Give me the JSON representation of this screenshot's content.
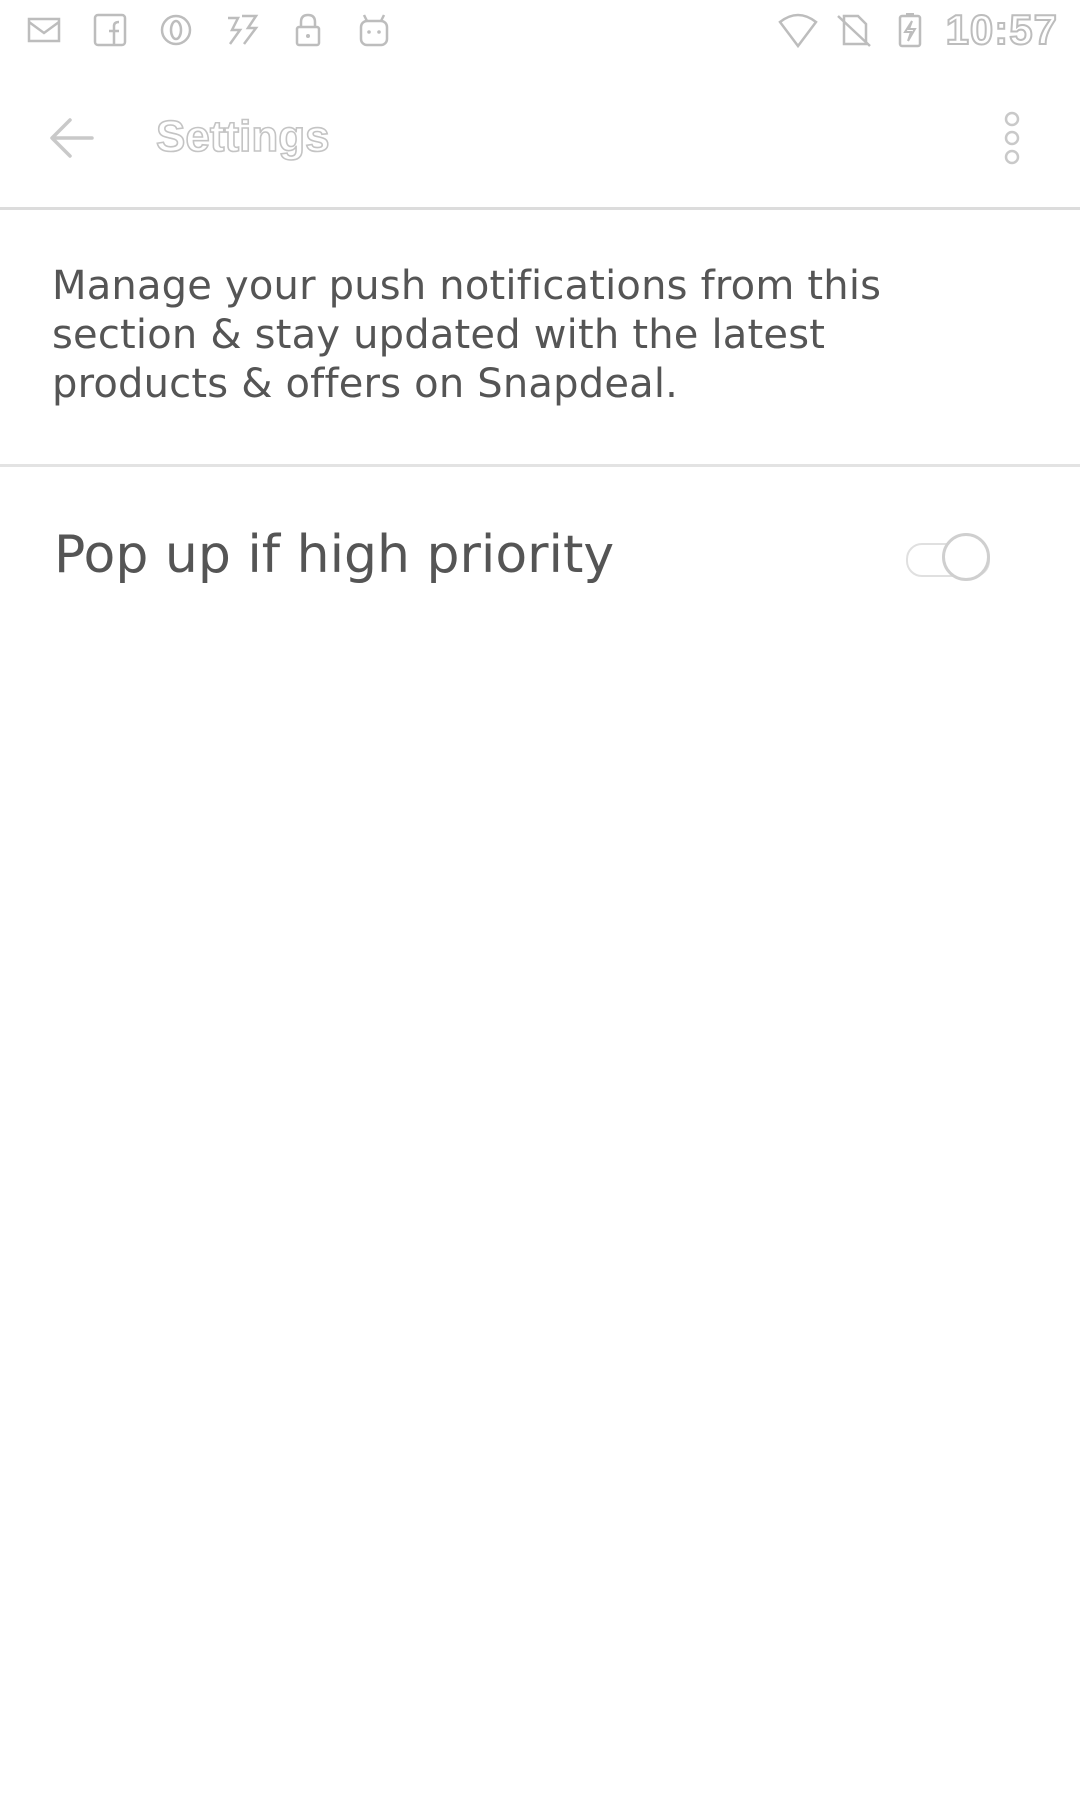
{
  "status_bar": {
    "time": "10:57",
    "left_icons": [
      "mail-icon",
      "facebook-icon",
      "opera-icon",
      "game-icon",
      "lock-icon",
      "android-icon"
    ],
    "right_icons": [
      "wifi-icon",
      "no-sim-icon",
      "battery-charging-icon"
    ]
  },
  "app_bar": {
    "title": "Settings",
    "back_icon": "arrow-left-icon",
    "menu_icon": "more-vert-icon"
  },
  "content": {
    "description": "Manage your push notifications from this section & stay updated with the latest products & offers on Snapdeal.",
    "settings": [
      {
        "label": "Pop up if high priority",
        "enabled": false
      }
    ]
  }
}
